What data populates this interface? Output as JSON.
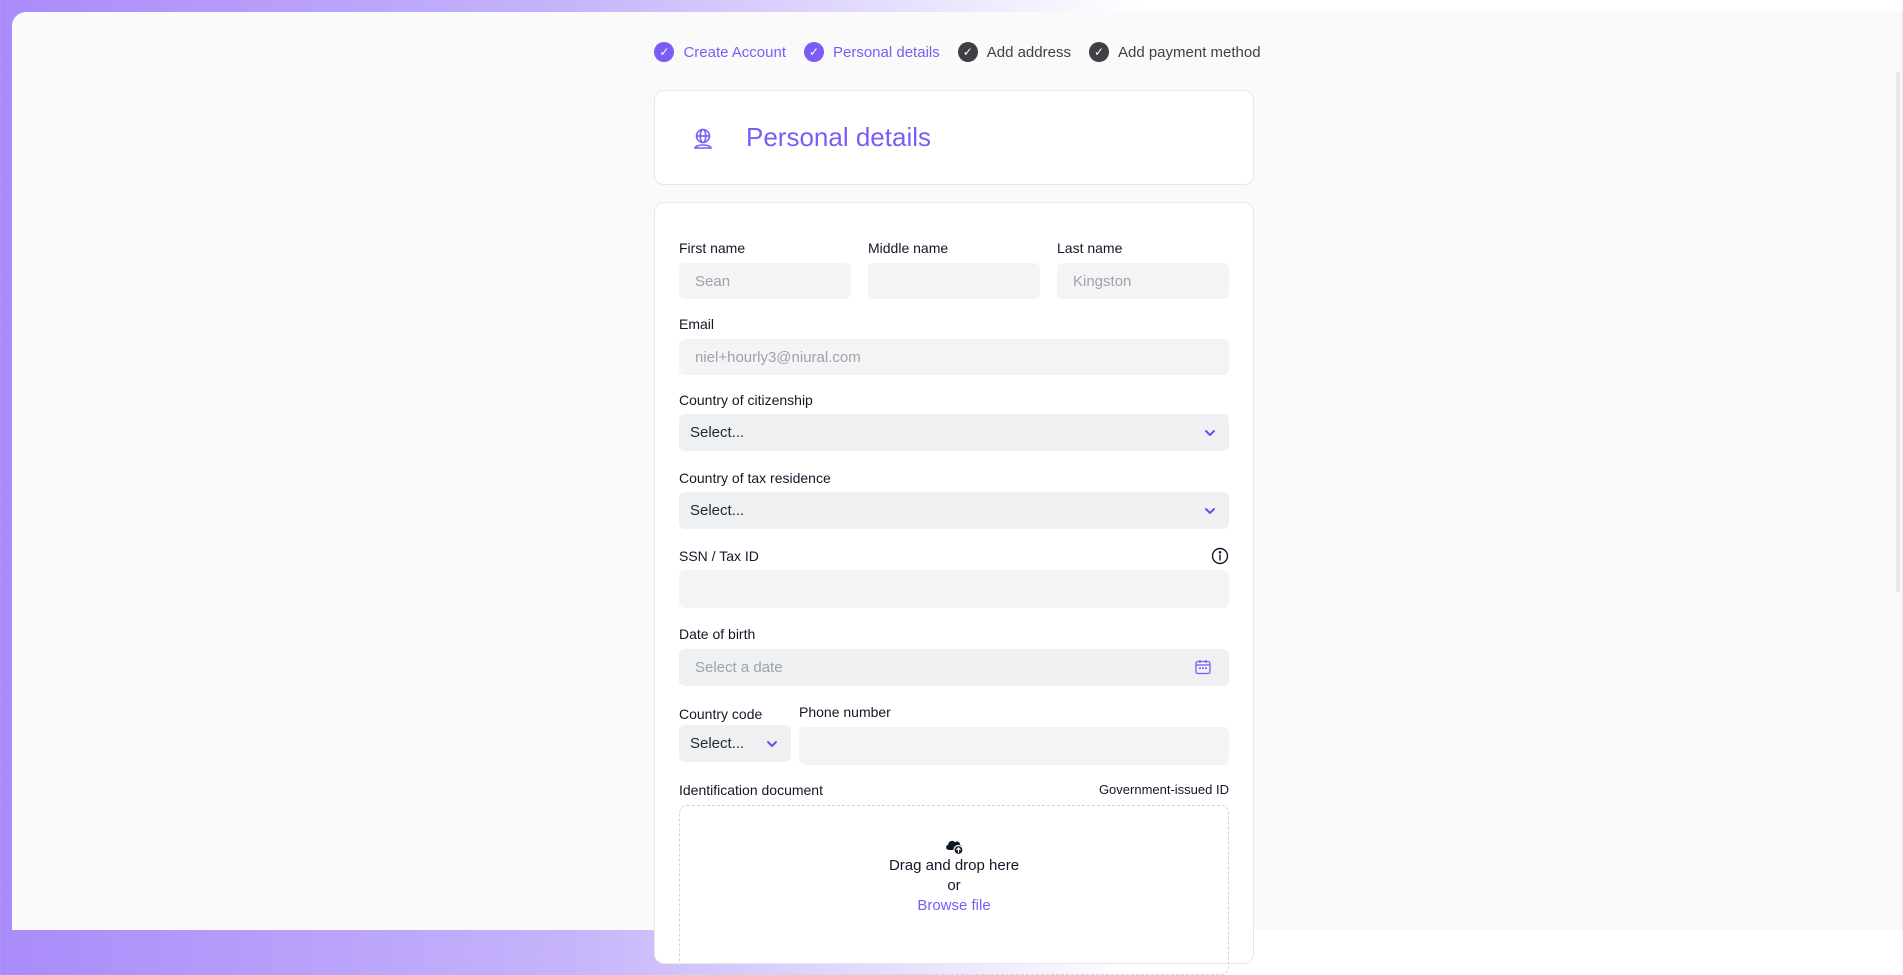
{
  "stepper": {
    "steps": [
      {
        "label": "Create Account",
        "status": "completed"
      },
      {
        "label": "Personal details",
        "status": "current"
      },
      {
        "label": "Add address",
        "status": "pending"
      },
      {
        "label": "Add payment method",
        "status": "pending"
      }
    ]
  },
  "header": {
    "title": "Personal details",
    "icon": "globe-user-icon"
  },
  "form": {
    "first_name": {
      "label": "First name",
      "placeholder": "Sean",
      "value": ""
    },
    "middle_name": {
      "label": "Middle name",
      "placeholder": "",
      "value": ""
    },
    "last_name": {
      "label": "Last name",
      "placeholder": "Kingston",
      "value": ""
    },
    "email": {
      "label": "Email",
      "placeholder": "niel+hourly3@niural.com",
      "value": ""
    },
    "citizenship": {
      "label": "Country of citizenship",
      "value": "Select..."
    },
    "tax_residence": {
      "label": "Country of tax residence",
      "value": "Select..."
    },
    "ssn": {
      "label": "SSN / Tax ID",
      "value": ""
    },
    "dob": {
      "label": "Date of birth",
      "placeholder": "Select a date"
    },
    "country_code": {
      "label": "Country code",
      "value": "Select..."
    },
    "phone": {
      "label": "Phone number",
      "value": ""
    },
    "id_document": {
      "label": "Identification document",
      "hint": "Government-issued ID",
      "drop_text": "Drag and drop here",
      "or_text": "or",
      "browse_label": "Browse file"
    }
  },
  "colors": {
    "accent": "#7c5cf5",
    "pending_step": "#3f3f46",
    "field_bg": "#f4f4f5"
  }
}
